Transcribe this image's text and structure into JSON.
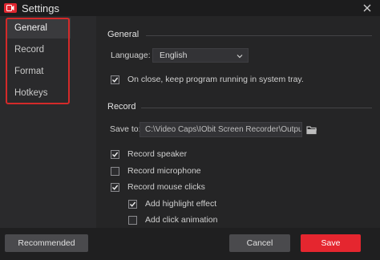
{
  "window": {
    "title": "Settings"
  },
  "sidebar": {
    "items": [
      {
        "label": "General",
        "active": true
      },
      {
        "label": "Record",
        "active": false
      },
      {
        "label": "Format",
        "active": false
      },
      {
        "label": "Hotkeys",
        "active": false
      }
    ]
  },
  "general": {
    "section_title": "General",
    "language_label": "Language:",
    "language_value": "English",
    "tray_option": {
      "label": "On close, keep program running in system tray.",
      "checked": true
    }
  },
  "record": {
    "section_title": "Record",
    "save_to_label": "Save to:",
    "save_to_value": "C:\\Video Caps\\IObit Screen Recorder\\Outpu",
    "options": [
      {
        "label": "Record speaker",
        "checked": true
      },
      {
        "label": "Record microphone",
        "checked": false
      },
      {
        "label": "Record mouse clicks",
        "checked": true
      },
      {
        "label": "Add highlight effect",
        "checked": true
      },
      {
        "label": "Add click animation",
        "checked": false
      }
    ]
  },
  "footer": {
    "recommended_label": "Recommended",
    "cancel_label": "Cancel",
    "save_label": "Save"
  },
  "colors": {
    "accent": "#e5262f",
    "highlight_border": "#d42a2a",
    "background": "#252526"
  }
}
